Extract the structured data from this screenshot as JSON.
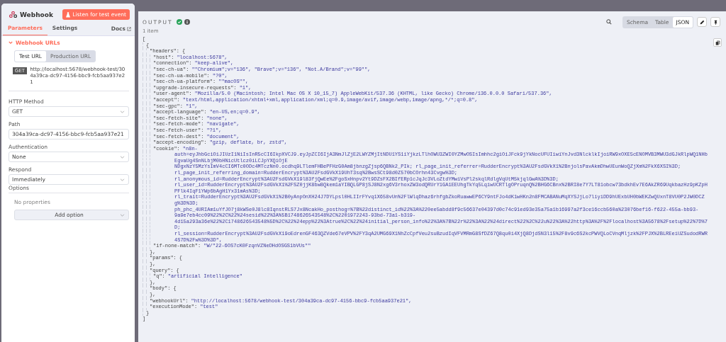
{
  "node": {
    "title": "Webhook",
    "listen_button": "Listen for test event"
  },
  "tabs": [
    {
      "label": "Parameters",
      "selected": true
    },
    {
      "label": "Settings",
      "selected": false
    }
  ],
  "docs_link": "Docs",
  "webhook_urls": {
    "title": "Webhook URLs",
    "expanded": true,
    "url_tabs": [
      {
        "label": "Test URL",
        "selected": true
      },
      {
        "label": "Production URL",
        "selected": false
      }
    ],
    "method": "GET",
    "url": "http://localhost:5678/webhook-test/304a39ca-dc97-4156-bbc9-fcb5aa937e21"
  },
  "fields": [
    {
      "label": "HTTP Method",
      "kind": "select",
      "value": "GET"
    },
    {
      "label": "Path",
      "kind": "input",
      "value": "304a39ca-dc97-4156-bbc9-fcb5aa937e21"
    },
    {
      "label": "Authentication",
      "kind": "select",
      "value": "None"
    },
    {
      "label": "Respond",
      "kind": "select",
      "value": "Immediately"
    }
  ],
  "options": {
    "label": "Options",
    "empty_text": "No properties",
    "add_button": "Add option"
  },
  "output": {
    "title": "OUTPUT",
    "item_count": "1 item",
    "views": [
      {
        "label": "Schema",
        "selected": false
      },
      {
        "label": "Table",
        "selected": false
      },
      {
        "label": "JSON",
        "selected": true
      }
    ]
  },
  "json": {
    "open": "[",
    "close": "]",
    "children": [
      {
        "open": "{",
        "close": "}",
        "children": [
          {
            "key": "\"headers\":",
            "open": "{",
            "close": "},",
            "children": [
              {
                "key": "\"host\":",
                "value": "\"localhost:5678\","
              },
              {
                "key": "\"connection\":",
                "value": "\"keep-alive\","
              },
              {
                "key": "\"sec-ch-ua\":",
                "value": "\"\"Chromium\";v=\"136\", \"Brave\";v=\"136\", \"Not.A/Brand\";v=\"99\"\","
              },
              {
                "key": "\"sec-ch-ua-mobile\":",
                "value": "\"?0\","
              },
              {
                "key": "\"sec-ch-ua-platform\":",
                "value": "\"\"macOS\"\","
              },
              {
                "key": "\"upgrade-insecure-requests\":",
                "value": "\"1\","
              },
              {
                "key": "\"user-agent\":",
                "value": "\"Mozilla/5.0 (Macintosh; Intel Mac OS X 10_15_7) AppleWebKit/537.36 (KHTML, like Gecko) Chrome/136.0.0.0 Safari/537.36\","
              },
              {
                "key": "\"accept\":",
                "value": "\"text/html,application/xhtml+xml,application/xml;q=0.9,image/avif,image/webp,image/apng,*/*;q=0.8\","
              },
              {
                "key": "\"sec-gpc\":",
                "value": "\"1\","
              },
              {
                "key": "\"accept-language\":",
                "value": "\"en-US,en;q=0.9\","
              },
              {
                "key": "\"sec-fetch-site\":",
                "value": "\"none\","
              },
              {
                "key": "\"sec-fetch-mode\":",
                "value": "\"navigate\","
              },
              {
                "key": "\"sec-fetch-user\":",
                "value": "\"?1\","
              },
              {
                "key": "\"sec-fetch-dest\":",
                "value": "\"document\","
              },
              {
                "key": "\"accept-encoding\":",
                "value": "\"gzip, deflate, br, zstd\","
              },
              {
                "key": "\"cookie\":",
                "value": "\"n8n-",
                "continuation": [
                  "auth=eyJhbGciOiJIUzI1NiIsInR5cCI6IkpXVCJ9.eyJpZCI6IjA3NmJlZjE2LWYZMjItNDU1YS1iYjkzLTlhOWU3ZWI0YZMwOSIsImhhc2giOiJFck9jYkNocUFUIiwiYnJvd3NlcklkIjoiRW9xOXE5cENOMVB3MWU3dGJkRlpWQ1NHbEgvaUg4SnNLbjM0bHNicUtlcz0iLCJpYXQiOjE",
                  "NDgxNzY5MzYsImV4cCI6MTc0ODc4MTczNn0.ocdhq9LTlemFHBePFHzG0Am8jbnzgZjsp6QBNk2_PIk; rl_page_init_referrer=RudderEncrypt%3AU2FsdGVkX1%2BnjolsPavAkmDhwUEunWoQZjXm%2FkX6XSI%3D;",
                  "rl_page_init_referring_domain=RudderEncrypt%3AU2FsdGVkX19UhT3sq%2BwsSCt98d0Z570bCOrhn43Cvgw%3D;",
                  "rl_anonymous_id=RudderEncrypt%3AU2FsdGVkX19l83fjQwEe%2FgoSxHnpv2Yt9DZsFX2BIfERp1cJqJc3VLoZtdYMwiVsPl2skqlRdlgVqUtM5kjqlGwA%3D%3D;",
                  "rl_user_id=RudderEncrypt%3AU2FsdGVkX1%2FSZ0jjK8bw8Qkem1aYIBQLGP8jSJ8N2xg6V3rhoxZW3odQRUrY1GA1EEUhgTkYq5LqiwUCRTlgOPruqnQ%2BHG6CBnx%2BRI8e7Y7LT81obcw73bdkhEv7E6AkZR69UqkbazHz9pKZpHPFlk4IqF1YWp6bAgH1Yx31mAs%3D;",
                  "rl_trait=RudderEncrypt%3AU2FsdGVkX1%2B0yAnpOnXH24J7DYLpsl0HLIIrFYvq1X658vUn%2FlWlqDhaz6rhfgbZkoRuawwEP6CY9ntFJo4dK1wHKn2n8FMCABANuMqXYSJjLo7liyiDD9hUExbUH0bWEKZwQUxnT8VU0P2JW0DCZg%3D%3D;",
                  "ph_phc_4URIAm1uYfJO7j8kWSe0J8lc8IqnstRLS7Jx8NcakHo_posthog=%7B%22distinct_id%22%3A%220ee5abdd8f9c56637e04397d0c74c91ed93e35a75a1b16997a2f3ce16ccb560a%23076bef16-f622-455a-bb93-",
                  "9a9e7eb4cc09%22%2C%22%24sesid%22%3A%5B1748626543548%2C%2201972243-93bd-73a1-b319-",
                  "4d15a293a36e%22%2C1748626543548%5D%2C%22%24epp%22%3Atrue%2C%22%24initial_person_info%22%3A%7B%22r%22%3A%22%24direct%22%2C%22u%22%3A%22http%3A%2F%2Flocalhost%3A5678%2Fsetup%22%7D%7D;",
                  "rl_session=RudderEncrypt%3AU2FsdGVkX19oEdrenGF463QZVde67eVPV%2FY3qA2UMG69X1NhZcCpfVeu2suBzudIqVFVMRmG8SfDZ67Q8qu0i4XjQ8DjdSN3l15%2F8v9c6S2kcPWVQLoCVnqMljzk%2FPJX%2BLREeiUZSudodRWR4S7D%2Fw%3D%3D\","
                ]
              },
              {
                "key": "\"if-none-match\":",
                "value": "\"W/\"22-6OS7cK0FzqnVZNeDHdOSGS1bVUs\"\""
              }
            ]
          },
          {
            "key": "\"params\":",
            "open": "{",
            "close": "},"
          },
          {
            "key": "\"query\":",
            "open": "{",
            "close": "},",
            "children": [
              {
                "key": "\"q\":",
                "value": "\"artificial Intelligence\""
              }
            ]
          },
          {
            "key": "\"body\":",
            "open": "{",
            "close": "},"
          },
          {
            "key": "\"webhookUrl\":",
            "value": "\"http://localhost:5678/webhook-test/304a39ca-dc97-4156-bbc9-fcb5aa937e21\","
          },
          {
            "key": "\"executionMode\":",
            "value": "\"test\""
          }
        ]
      }
    ]
  }
}
